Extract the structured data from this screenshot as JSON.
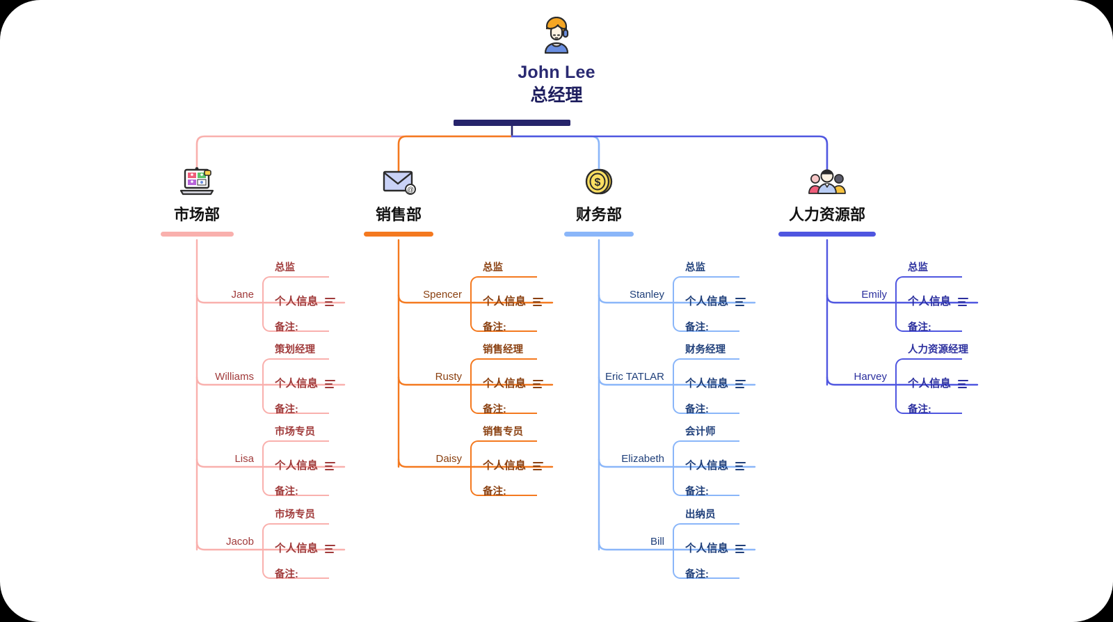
{
  "colors": {
    "root": "#26246b",
    "marketing": "#f9b0ad",
    "marketing_text": "#a03a3a",
    "sales": "#f4791f",
    "sales_text": "#8a4010",
    "finance": "#8ab6f9",
    "finance_text": "#1f3f7a",
    "hr": "#4f56e0",
    "hr_text": "#2b2f9e",
    "dept_label": "#111111",
    "name_text": "#333333",
    "canvas": "#ffffff",
    "page": "#000000"
  },
  "root": {
    "name": "John Lee",
    "title": "总经理",
    "avatar_icon": "person-headset-avatar-icon"
  },
  "labels": {
    "info": "个人信息",
    "note": "备注:",
    "menu_icon": "hamburger-menu-icon"
  },
  "departments": [
    {
      "id": "marketing",
      "label": "市场部",
      "icon": "video-conference-icon",
      "color": "#f9b0ad",
      "text_color": "#a03a3a",
      "people": [
        {
          "name": "Jane",
          "role": "总监"
        },
        {
          "name": "Williams",
          "role": "策划经理"
        },
        {
          "name": "Lisa",
          "role": "市场专员"
        },
        {
          "name": "Jacob",
          "role": "市场专员"
        }
      ]
    },
    {
      "id": "sales",
      "label": "销售部",
      "icon": "email-envelope-icon",
      "color": "#f4791f",
      "text_color": "#8a4010",
      "people": [
        {
          "name": "Spencer",
          "role": "总监"
        },
        {
          "name": "Rusty",
          "role": "销售经理"
        },
        {
          "name": "Daisy",
          "role": "销售专员"
        }
      ]
    },
    {
      "id": "finance",
      "label": "财务部",
      "icon": "dollar-coin-icon",
      "color": "#8ab6f9",
      "text_color": "#1f3f7a",
      "people": [
        {
          "name": "Stanley",
          "role": "总监"
        },
        {
          "name": "Eric TATLAR",
          "role": "财务经理"
        },
        {
          "name": "Elizabeth",
          "role": "会计师"
        },
        {
          "name": "Bill",
          "role": "出纳员"
        }
      ]
    },
    {
      "id": "hr",
      "label": "人力资源部",
      "icon": "people-group-icon",
      "color": "#4f56e0",
      "text_color": "#2b2f9e",
      "people": [
        {
          "name": "Emily",
          "role": "总监"
        },
        {
          "name": "Harvey",
          "role": "人力资源经理"
        }
      ]
    }
  ]
}
